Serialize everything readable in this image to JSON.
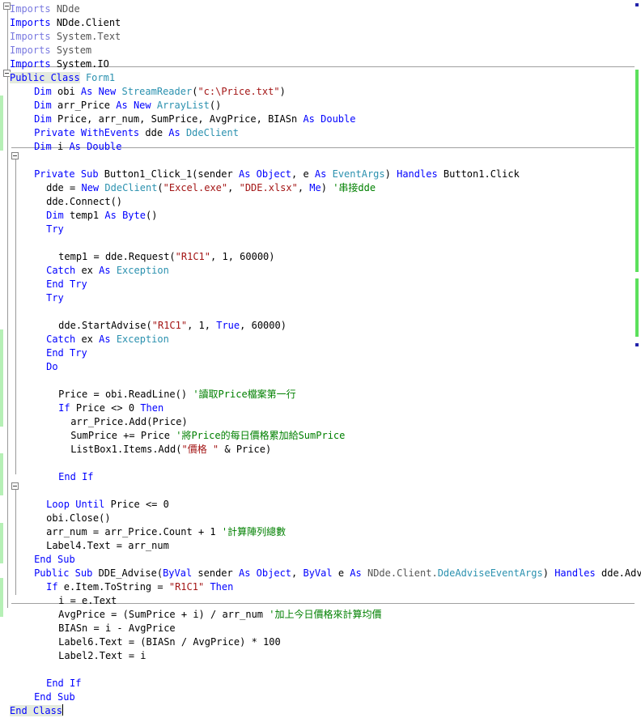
{
  "app": {
    "kind": "code-editor",
    "language": "Visual Basic .NET",
    "colors": {
      "keyword": "#0000ff",
      "type": "#2b91af",
      "string": "#a31515",
      "comment": "#008000",
      "identifier": "#000000",
      "background": "#ffffff",
      "selection_highlight": "#e4eade",
      "change_bar": "#b6f0b6",
      "marker_track": "#5ce05c",
      "gutter_line": "#9a9a9a"
    },
    "gutter": {
      "outline_toggles": [
        "collapse-box",
        "collapse-box",
        "collapse-box",
        "collapse-box"
      ],
      "toggle_glyph": "minus"
    }
  },
  "code": {
    "lines": [
      {
        "indent": 0,
        "outline": "collapse",
        "tokens": [
          {
            "t": "Imports",
            "c": "kwlight"
          },
          {
            "t": " ",
            "c": "id"
          },
          {
            "t": "NDde",
            "c": "dim"
          }
        ]
      },
      {
        "indent": 0,
        "tokens": [
          {
            "t": "Imports",
            "c": "kw"
          },
          {
            "t": " ",
            "c": "id"
          },
          {
            "t": "NDde.Client",
            "c": "id"
          }
        ]
      },
      {
        "indent": 0,
        "tokens": [
          {
            "t": "Imports",
            "c": "kwlight"
          },
          {
            "t": " ",
            "c": "id"
          },
          {
            "t": "System.Text",
            "c": "dim"
          }
        ]
      },
      {
        "indent": 0,
        "tokens": [
          {
            "t": "Imports",
            "c": "kwlight"
          },
          {
            "t": " ",
            "c": "id"
          },
          {
            "t": "System",
            "c": "dim"
          }
        ]
      },
      {
        "indent": 0,
        "tokens": [
          {
            "t": "Imports",
            "c": "kw"
          },
          {
            "t": " ",
            "c": "id"
          },
          {
            "t": "System.IO",
            "c": "id"
          }
        ]
      },
      {
        "indent": 0,
        "outline": "collapse",
        "highlight": true,
        "tokens": [
          {
            "t": "Public Class",
            "c": "kw",
            "hl": true
          },
          {
            "t": " ",
            "c": "id"
          },
          {
            "t": "Form1",
            "c": "typ"
          }
        ]
      },
      {
        "indent": 2,
        "tokens": [
          {
            "t": "Dim",
            "c": "kw"
          },
          {
            "t": " obi ",
            "c": "id"
          },
          {
            "t": "As",
            "c": "kw"
          },
          {
            "t": " ",
            "c": "id"
          },
          {
            "t": "New",
            "c": "kw"
          },
          {
            "t": " ",
            "c": "id"
          },
          {
            "t": "StreamReader",
            "c": "typ"
          },
          {
            "t": "(",
            "c": "id"
          },
          {
            "t": "\"c:\\Price.txt\"",
            "c": "str"
          },
          {
            "t": ")",
            "c": "id"
          }
        ]
      },
      {
        "indent": 2,
        "tokens": [
          {
            "t": "Dim",
            "c": "kw"
          },
          {
            "t": " arr_Price ",
            "c": "id"
          },
          {
            "t": "As",
            "c": "kw"
          },
          {
            "t": " ",
            "c": "id"
          },
          {
            "t": "New",
            "c": "kw"
          },
          {
            "t": " ",
            "c": "id"
          },
          {
            "t": "ArrayList",
            "c": "typ"
          },
          {
            "t": "()",
            "c": "id"
          }
        ]
      },
      {
        "indent": 2,
        "tokens": [
          {
            "t": "Dim",
            "c": "kw"
          },
          {
            "t": " Price, arr_num, SumPrice, AvgPrice, BIASn ",
            "c": "id"
          },
          {
            "t": "As",
            "c": "kw"
          },
          {
            "t": " ",
            "c": "id"
          },
          {
            "t": "Double",
            "c": "kw"
          }
        ]
      },
      {
        "indent": 2,
        "tokens": [
          {
            "t": "Private",
            "c": "kw"
          },
          {
            "t": " ",
            "c": "id"
          },
          {
            "t": "WithEvents",
            "c": "kw"
          },
          {
            "t": " dde ",
            "c": "id"
          },
          {
            "t": "As",
            "c": "kw"
          },
          {
            "t": " ",
            "c": "id"
          },
          {
            "t": "DdeClient",
            "c": "typ"
          }
        ]
      },
      {
        "indent": 2,
        "tokens": [
          {
            "t": "Dim",
            "c": "kw"
          },
          {
            "t": " i ",
            "c": "id"
          },
          {
            "t": "As",
            "c": "kw"
          },
          {
            "t": " ",
            "c": "id"
          },
          {
            "t": "Double",
            "c": "kw"
          }
        ]
      },
      {
        "indent": 0,
        "blank": true,
        "tokens": []
      },
      {
        "indent": 2,
        "outline": "collapse",
        "tokens": [
          {
            "t": "Private",
            "c": "kw"
          },
          {
            "t": " ",
            "c": "id"
          },
          {
            "t": "Sub",
            "c": "kw"
          },
          {
            "t": " Button1_Click_1(sender ",
            "c": "id"
          },
          {
            "t": "As",
            "c": "kw"
          },
          {
            "t": " ",
            "c": "id"
          },
          {
            "t": "Object",
            "c": "kw"
          },
          {
            "t": ", e ",
            "c": "id"
          },
          {
            "t": "As",
            "c": "kw"
          },
          {
            "t": " ",
            "c": "id"
          },
          {
            "t": "EventArgs",
            "c": "typ"
          },
          {
            "t": ") ",
            "c": "id"
          },
          {
            "t": "Handles",
            "c": "kw"
          },
          {
            "t": " Button1.Click",
            "c": "id"
          }
        ]
      },
      {
        "indent": 3,
        "tokens": [
          {
            "t": "dde = ",
            "c": "id"
          },
          {
            "t": "New",
            "c": "kw"
          },
          {
            "t": " ",
            "c": "id"
          },
          {
            "t": "DdeClient",
            "c": "typ"
          },
          {
            "t": "(",
            "c": "id"
          },
          {
            "t": "\"Excel.exe\"",
            "c": "str"
          },
          {
            "t": ", ",
            "c": "id"
          },
          {
            "t": "\"DDE.xlsx\"",
            "c": "str"
          },
          {
            "t": ", ",
            "c": "id"
          },
          {
            "t": "Me",
            "c": "kw"
          },
          {
            "t": ") ",
            "c": "id"
          },
          {
            "t": "'串接dde",
            "c": "cmt"
          }
        ]
      },
      {
        "indent": 3,
        "tokens": [
          {
            "t": "dde.Connect()",
            "c": "id"
          }
        ]
      },
      {
        "indent": 3,
        "tokens": [
          {
            "t": "Dim",
            "c": "kw"
          },
          {
            "t": " temp1 ",
            "c": "id"
          },
          {
            "t": "As",
            "c": "kw"
          },
          {
            "t": " ",
            "c": "id"
          },
          {
            "t": "Byte",
            "c": "kw"
          },
          {
            "t": "()",
            "c": "id"
          }
        ]
      },
      {
        "indent": 3,
        "tokens": [
          {
            "t": "Try",
            "c": "kw"
          }
        ]
      },
      {
        "indent": 0,
        "blank": true,
        "tokens": []
      },
      {
        "indent": 4,
        "tokens": [
          {
            "t": "temp1 = dde.Request(",
            "c": "id"
          },
          {
            "t": "\"R1C1\"",
            "c": "str"
          },
          {
            "t": ", 1, 60000)",
            "c": "id"
          }
        ]
      },
      {
        "indent": 3,
        "tokens": [
          {
            "t": "Catch",
            "c": "kw"
          },
          {
            "t": " ex ",
            "c": "id"
          },
          {
            "t": "As",
            "c": "kw"
          },
          {
            "t": " ",
            "c": "id"
          },
          {
            "t": "Exception",
            "c": "typ"
          }
        ]
      },
      {
        "indent": 3,
        "tokens": [
          {
            "t": "End",
            "c": "kw"
          },
          {
            "t": " ",
            "c": "id"
          },
          {
            "t": "Try",
            "c": "kw"
          }
        ]
      },
      {
        "indent": 3,
        "tokens": [
          {
            "t": "Try",
            "c": "kw"
          }
        ]
      },
      {
        "indent": 0,
        "blank": true,
        "tokens": []
      },
      {
        "indent": 4,
        "tokens": [
          {
            "t": "dde.StartAdvise(",
            "c": "id"
          },
          {
            "t": "\"R1C1\"",
            "c": "str"
          },
          {
            "t": ", 1, ",
            "c": "id"
          },
          {
            "t": "True",
            "c": "kw"
          },
          {
            "t": ", 60000)",
            "c": "id"
          }
        ]
      },
      {
        "indent": 3,
        "tokens": [
          {
            "t": "Catch",
            "c": "kw"
          },
          {
            "t": " ex ",
            "c": "id"
          },
          {
            "t": "As",
            "c": "kw"
          },
          {
            "t": " ",
            "c": "id"
          },
          {
            "t": "Exception",
            "c": "typ"
          }
        ]
      },
      {
        "indent": 3,
        "tokens": [
          {
            "t": "End",
            "c": "kw"
          },
          {
            "t": " ",
            "c": "id"
          },
          {
            "t": "Try",
            "c": "kw"
          }
        ]
      },
      {
        "indent": 3,
        "tokens": [
          {
            "t": "Do",
            "c": "kw"
          }
        ]
      },
      {
        "indent": 0,
        "blank": true,
        "tokens": []
      },
      {
        "indent": 4,
        "tokens": [
          {
            "t": "Price = obi.ReadLine() ",
            "c": "id"
          },
          {
            "t": "'讀取Price檔案第一行",
            "c": "cmt"
          }
        ]
      },
      {
        "indent": 4,
        "tokens": [
          {
            "t": "If",
            "c": "kw"
          },
          {
            "t": " Price <> 0 ",
            "c": "id"
          },
          {
            "t": "Then",
            "c": "kw"
          }
        ]
      },
      {
        "indent": 5,
        "tokens": [
          {
            "t": "arr_Price.Add(Price)",
            "c": "id"
          }
        ]
      },
      {
        "indent": 5,
        "tokens": [
          {
            "t": "SumPrice += Price ",
            "c": "id"
          },
          {
            "t": "'將Price的每日價格累加給SumPrice",
            "c": "cmt"
          }
        ]
      },
      {
        "indent": 5,
        "tokens": [
          {
            "t": "ListBox1.Items.Add(",
            "c": "id"
          },
          {
            "t": "\"價格 \"",
            "c": "str"
          },
          {
            "t": " & Price)",
            "c": "id"
          }
        ]
      },
      {
        "indent": 0,
        "blank": true,
        "tokens": []
      },
      {
        "indent": 4,
        "tokens": [
          {
            "t": "End",
            "c": "kw"
          },
          {
            "t": " ",
            "c": "id"
          },
          {
            "t": "If",
            "c": "kw"
          }
        ]
      },
      {
        "indent": 0,
        "blank": true,
        "tokens": []
      },
      {
        "indent": 3,
        "tokens": [
          {
            "t": "Loop",
            "c": "kw"
          },
          {
            "t": " ",
            "c": "id"
          },
          {
            "t": "Until",
            "c": "kw"
          },
          {
            "t": " Price <= 0",
            "c": "id"
          }
        ]
      },
      {
        "indent": 3,
        "tokens": [
          {
            "t": "obi.Close()",
            "c": "id"
          }
        ]
      },
      {
        "indent": 3,
        "tokens": [
          {
            "t": "arr_num = arr_Price.Count + 1 ",
            "c": "id"
          },
          {
            "t": "'計算陣列總數",
            "c": "cmt"
          }
        ]
      },
      {
        "indent": 3,
        "tokens": [
          {
            "t": "Label4.Text = arr_num",
            "c": "id"
          }
        ]
      },
      {
        "indent": 2,
        "tokens": [
          {
            "t": "End",
            "c": "kw"
          },
          {
            "t": " ",
            "c": "id"
          },
          {
            "t": "Sub",
            "c": "kw"
          }
        ]
      },
      {
        "indent": 2,
        "outline": "collapse",
        "tokens": [
          {
            "t": "Public",
            "c": "kw"
          },
          {
            "t": " ",
            "c": "id"
          },
          {
            "t": "Sub",
            "c": "kw"
          },
          {
            "t": " DDE_Advise(",
            "c": "id"
          },
          {
            "t": "ByVal",
            "c": "kw"
          },
          {
            "t": " sender ",
            "c": "id"
          },
          {
            "t": "As",
            "c": "kw"
          },
          {
            "t": " ",
            "c": "id"
          },
          {
            "t": "Object",
            "c": "kw"
          },
          {
            "t": ", ",
            "c": "id"
          },
          {
            "t": "ByVal",
            "c": "kw"
          },
          {
            "t": " e ",
            "c": "id"
          },
          {
            "t": "As",
            "c": "kw"
          },
          {
            "t": " ",
            "c": "id"
          },
          {
            "t": "NDde.Client.",
            "c": "dim"
          },
          {
            "t": "DdeAdviseEventArgs",
            "c": "typ"
          },
          {
            "t": ") ",
            "c": "id"
          },
          {
            "t": "Handles",
            "c": "kw"
          },
          {
            "t": " dde.Advise",
            "c": "id"
          }
        ]
      },
      {
        "indent": 3,
        "tokens": [
          {
            "t": "If",
            "c": "kw"
          },
          {
            "t": " e.Item.ToString = ",
            "c": "id"
          },
          {
            "t": "\"R1C1\"",
            "c": "str"
          },
          {
            "t": " ",
            "c": "id"
          },
          {
            "t": "Then",
            "c": "kw"
          }
        ]
      },
      {
        "indent": 4,
        "tokens": [
          {
            "t": "i = e.Text",
            "c": "id"
          }
        ]
      },
      {
        "indent": 4,
        "tokens": [
          {
            "t": "AvgPrice = (SumPrice + i) / arr_num ",
            "c": "id"
          },
          {
            "t": "'加上今日價格來計算均價",
            "c": "cmt"
          }
        ]
      },
      {
        "indent": 4,
        "tokens": [
          {
            "t": "BIASn = i - AvgPrice",
            "c": "id"
          }
        ]
      },
      {
        "indent": 4,
        "tokens": [
          {
            "t": "Label6.Text = (BIASn / AvgPrice) * 100",
            "c": "id"
          }
        ]
      },
      {
        "indent": 4,
        "tokens": [
          {
            "t": "Label2.Text = i",
            "c": "id"
          }
        ]
      },
      {
        "indent": 0,
        "blank": true,
        "tokens": []
      },
      {
        "indent": 3,
        "tokens": [
          {
            "t": "End",
            "c": "kw"
          },
          {
            "t": " ",
            "c": "id"
          },
          {
            "t": "If",
            "c": "kw"
          }
        ]
      },
      {
        "indent": 2,
        "tokens": [
          {
            "t": "End",
            "c": "kw"
          },
          {
            "t": " ",
            "c": "id"
          },
          {
            "t": "Sub",
            "c": "kw"
          }
        ]
      },
      {
        "indent": 0,
        "highlight": true,
        "caret": true,
        "tokens": [
          {
            "t": "End Class",
            "c": "kw",
            "hl": true
          }
        ]
      }
    ]
  }
}
